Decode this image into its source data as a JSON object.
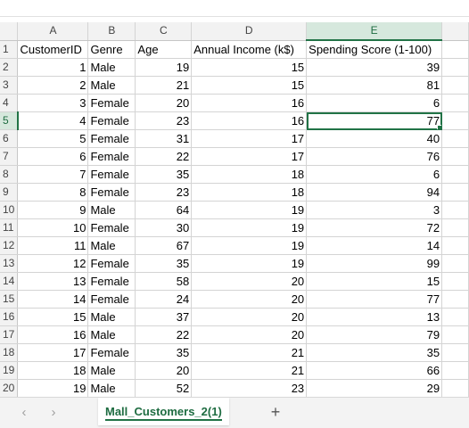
{
  "sheet": {
    "columns": [
      "A",
      "B",
      "C",
      "D",
      "E"
    ],
    "active_column": "E",
    "active_row": "5",
    "rows": [
      {
        "row": "1",
        "cells": [
          "CustomerID",
          "Genre",
          "Age",
          "Annual Income (k$)",
          "Spending Score (1-100)"
        ]
      },
      {
        "row": "2",
        "cells": [
          "1",
          "Male",
          "19",
          "15",
          "39"
        ]
      },
      {
        "row": "3",
        "cells": [
          "2",
          "Male",
          "21",
          "15",
          "81"
        ]
      },
      {
        "row": "4",
        "cells": [
          "3",
          "Female",
          "20",
          "16",
          "6"
        ]
      },
      {
        "row": "5",
        "cells": [
          "4",
          "Female",
          "23",
          "16",
          "77"
        ]
      },
      {
        "row": "6",
        "cells": [
          "5",
          "Female",
          "31",
          "17",
          "40"
        ]
      },
      {
        "row": "7",
        "cells": [
          "6",
          "Female",
          "22",
          "17",
          "76"
        ]
      },
      {
        "row": "8",
        "cells": [
          "7",
          "Female",
          "35",
          "18",
          "6"
        ]
      },
      {
        "row": "9",
        "cells": [
          "8",
          "Female",
          "23",
          "18",
          "94"
        ]
      },
      {
        "row": "10",
        "cells": [
          "9",
          "Male",
          "64",
          "19",
          "3"
        ]
      },
      {
        "row": "11",
        "cells": [
          "10",
          "Female",
          "30",
          "19",
          "72"
        ]
      },
      {
        "row": "12",
        "cells": [
          "11",
          "Male",
          "67",
          "19",
          "14"
        ]
      },
      {
        "row": "13",
        "cells": [
          "12",
          "Female",
          "35",
          "19",
          "99"
        ]
      },
      {
        "row": "14",
        "cells": [
          "13",
          "Female",
          "58",
          "20",
          "15"
        ]
      },
      {
        "row": "15",
        "cells": [
          "14",
          "Female",
          "24",
          "20",
          "77"
        ]
      },
      {
        "row": "16",
        "cells": [
          "15",
          "Male",
          "37",
          "20",
          "13"
        ]
      },
      {
        "row": "17",
        "cells": [
          "16",
          "Male",
          "22",
          "20",
          "79"
        ]
      },
      {
        "row": "18",
        "cells": [
          "17",
          "Female",
          "35",
          "21",
          "35"
        ]
      },
      {
        "row": "19",
        "cells": [
          "18",
          "Male",
          "20",
          "21",
          "66"
        ]
      },
      {
        "row": "20",
        "cells": [
          "19",
          "Male",
          "52",
          "23",
          "29"
        ]
      }
    ]
  },
  "tabbar": {
    "prev_icon": "chevron-left-icon",
    "next_icon": "chevron-right-icon",
    "prev_glyph": "‹",
    "next_glyph": "›",
    "sheet_name": "Mall_Customers_2(1)",
    "add_glyph": "+"
  },
  "colors": {
    "accent": "#217346",
    "header_bg": "#f2f2f2",
    "gridline": "#d4d4d4"
  }
}
